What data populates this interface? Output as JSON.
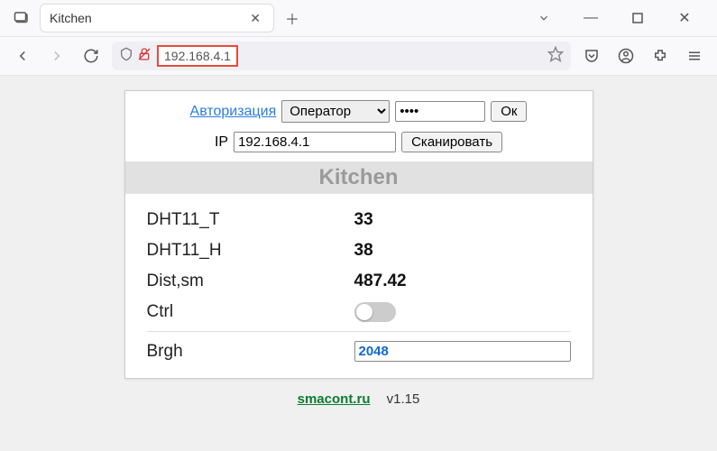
{
  "browser": {
    "tab_title": "Kitchen",
    "url_display": "192.168.4.1"
  },
  "auth": {
    "label": "Авторизация",
    "role": "Оператор",
    "password_mask": "●●●●",
    "ok": "Ок"
  },
  "ip": {
    "label": "IP",
    "value": "192.168.4.1",
    "scan": "Сканировать"
  },
  "device": {
    "title": "Kitchen"
  },
  "sensors": [
    {
      "label": "DHT11_T",
      "value": "33"
    },
    {
      "label": "DHT11_H",
      "value": "38"
    },
    {
      "label": "Dist,sm",
      "value": "487.42"
    }
  ],
  "controls": {
    "ctrl": {
      "label": "Ctrl",
      "state": "off"
    },
    "brgh": {
      "label": "Brgh",
      "value": "2048"
    }
  },
  "footer": {
    "link_text": "smacont.ru",
    "version": "v1.15"
  }
}
